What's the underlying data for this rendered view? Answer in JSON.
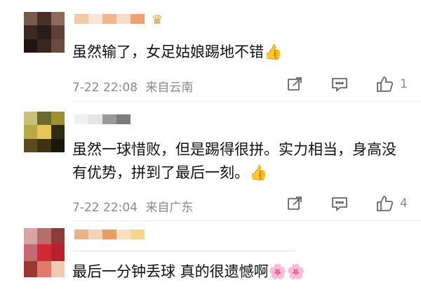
{
  "comments": [
    {
      "text": "虽然输了，女足姑娘踢地不错👍",
      "time": "7-22 22:08",
      "location": "来自云南",
      "likes": "1",
      "avatar_colors": [
        "#7a5a4a",
        "#4a3028",
        "#8c6a5c",
        "#3c2a22",
        "#2a1c18",
        "#5e4038",
        "#1e1412",
        "#3a2620",
        "#6b4b3e"
      ],
      "name_colors": [
        "#f3c9a8",
        "#f6e6d8",
        "#f2b592",
        "#f7ddc9",
        "#f0a276"
      ]
    },
    {
      "text": "虽然一球惜败，但是踢得很拼。实力相当，身高没有优势，拼到了最后一刻。👍",
      "time": "7-22 22:04",
      "location": "来自广东",
      "likes": "4",
      "avatar_colors": [
        "#c9c07a",
        "#6b6a2e",
        "#9e8f34",
        "#b8a847",
        "#e8c458",
        "#2e2a14",
        "#5a4b1e",
        "#3d3212",
        "#1c1608"
      ],
      "name_colors": [
        "#f0f0f0",
        "#e4e4e4",
        "#9a9a9a",
        "#7c7c7c"
      ]
    },
    {
      "text": "最后一分钟丢球 真的很遗憾啊🌸🌸",
      "avatar_colors": [
        "#d8a4a4",
        "#b86d6d",
        "#8e3a3a",
        "#c46a70",
        "#d12a36",
        "#b82030",
        "#9a3a2e",
        "#e07a6a",
        "#f2c9b4"
      ],
      "name_colors": [
        "#eab48a",
        "#f3d4b8",
        "#e79c6c",
        "#f7e0c0",
        "#f6d58e"
      ]
    }
  ],
  "icons": [
    "share-icon",
    "comment-icon",
    "like-icon"
  ]
}
